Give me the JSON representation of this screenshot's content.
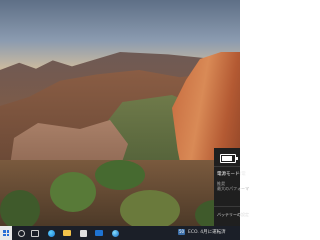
{
  "panel": {
    "battery_icon": "battery-icon",
    "battery_level_fraction": 0.8,
    "mode_label": "電源モード(電",
    "recommended_label": "推奨",
    "description_label": "最大のパフォーマ",
    "settings_link": "バッテリーの設定"
  },
  "taskbar": {
    "start_icon": "windows-start-icon",
    "icons": [
      "search-icon",
      "task-view-icon",
      "edge-icon",
      "file-explorer-icon",
      "store-icon",
      "mail-icon",
      "edge-beta-icon"
    ],
    "badge_label": "50",
    "status_text": "ECO. 4月に運転済"
  },
  "colors": {
    "taskbar_bg": "#1b1f28",
    "panel_bg": "#1f1f1f",
    "accent": "#2a6fd6"
  }
}
